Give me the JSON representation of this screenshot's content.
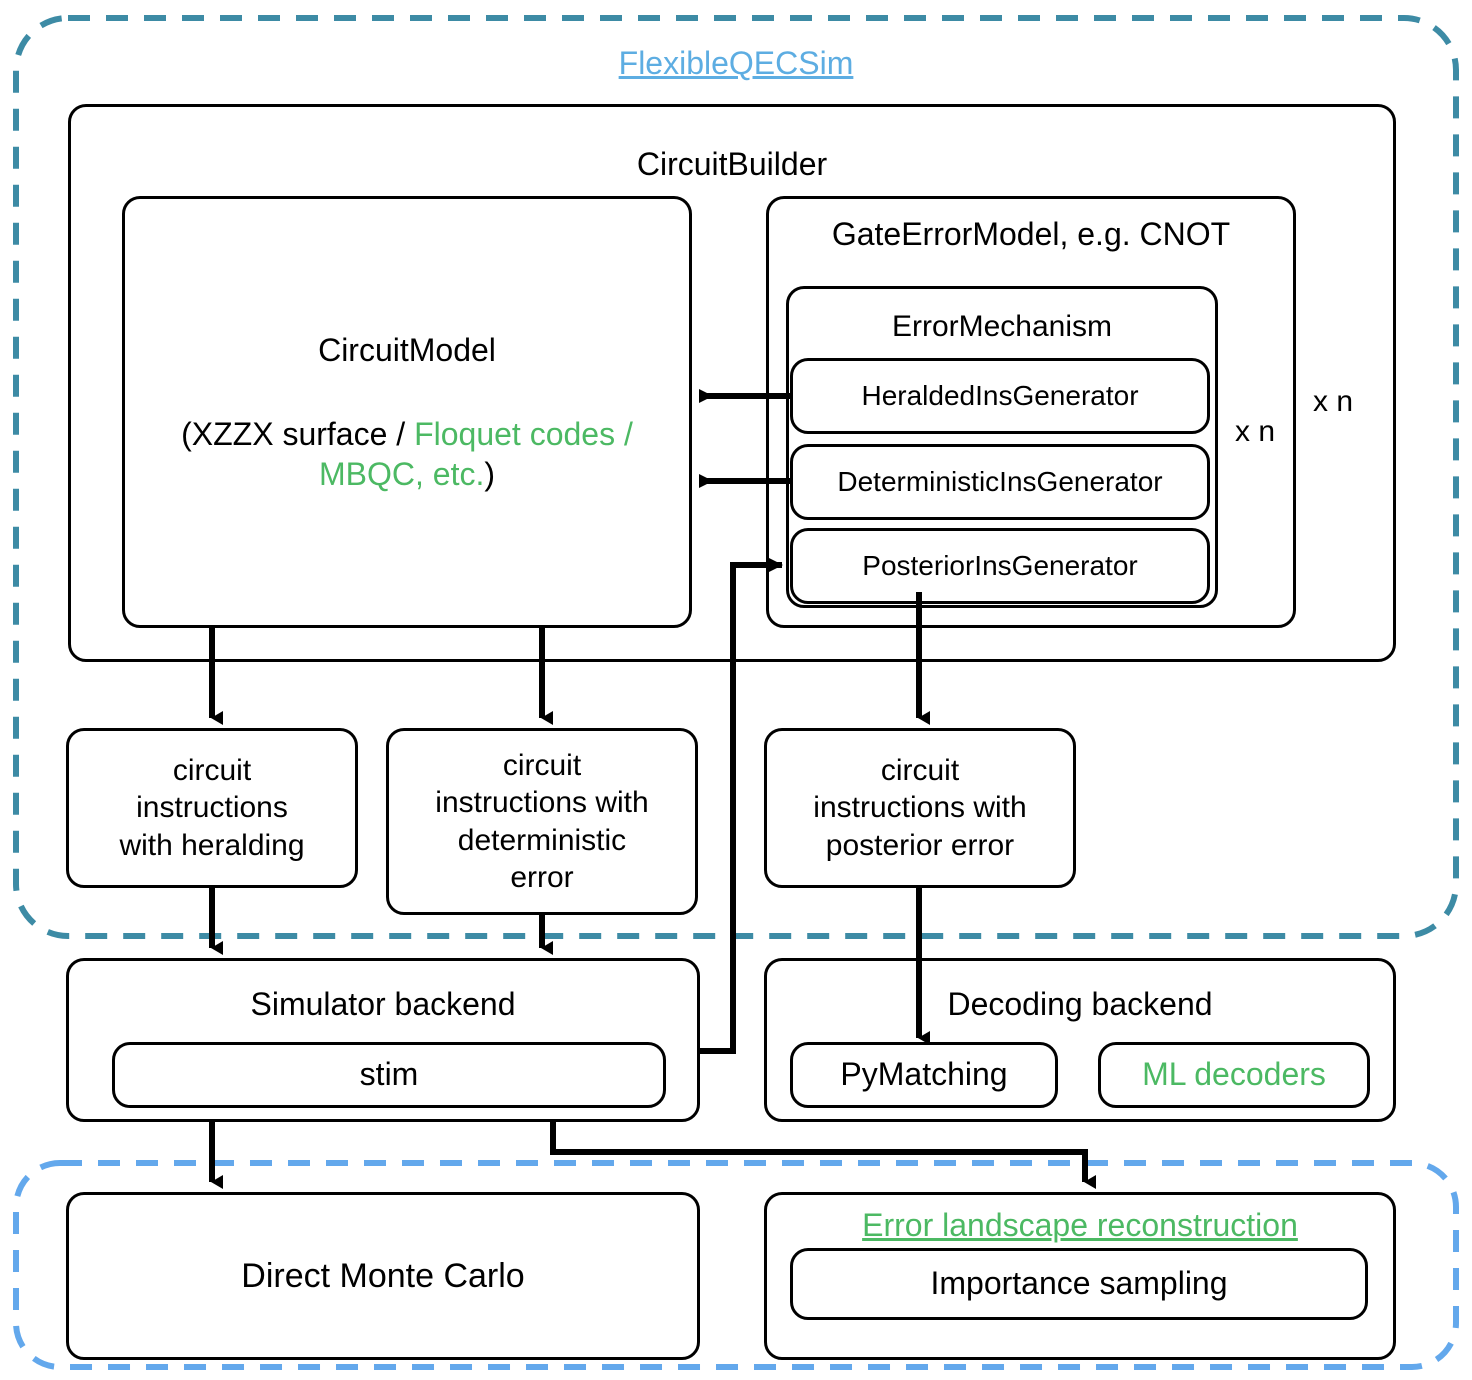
{
  "diagram": {
    "title": "FlexibleQECSim",
    "regions": {
      "top_dashed_color": "#3d8ba5",
      "bottom_dashed_color": "#63a8ec",
      "accent_green": "#4cb963",
      "accent_blue": "#5dade2",
      "stroke": "#000000"
    },
    "circuit_builder": {
      "title": "CircuitBuilder",
      "circuit_model": {
        "title": "CircuitModel",
        "subtitle_black_1": "(XZZX surface / ",
        "subtitle_green": "Floquet codes / MBQC, etc.",
        "subtitle_black_2": ")"
      },
      "gate_error_model": {
        "title": "GateErrorModel, e.g. CNOT",
        "multiplier_outer": "x n",
        "error_mechanism": {
          "title": "ErrorMechanism",
          "multiplier_inner": "x n",
          "generators": [
            {
              "label": "HeraldedInsGenerator"
            },
            {
              "label": "DeterministicInsGenerator"
            },
            {
              "label": "PosteriorInsGenerator"
            }
          ]
        }
      }
    },
    "instruction_boxes": [
      {
        "label": "circuit\ninstructions\nwith heralding"
      },
      {
        "label": "circuit\ninstructions with\ndeterministic\nerror"
      },
      {
        "label": "circuit\ninstructions with\nposterior error"
      }
    ],
    "backends": {
      "simulator": {
        "title": "Simulator backend",
        "items": [
          {
            "label": "stim"
          }
        ]
      },
      "decoding": {
        "title": "Decoding backend",
        "items": [
          {
            "label": "PyMatching",
            "green": false
          },
          {
            "label": "ML decoders",
            "green": true
          }
        ]
      }
    },
    "analysis": {
      "direct_monte_carlo": "Direct Monte Carlo",
      "error_landscape": {
        "title": "Error landscape reconstruction",
        "items": [
          {
            "label": "Importance sampling"
          }
        ]
      }
    }
  }
}
